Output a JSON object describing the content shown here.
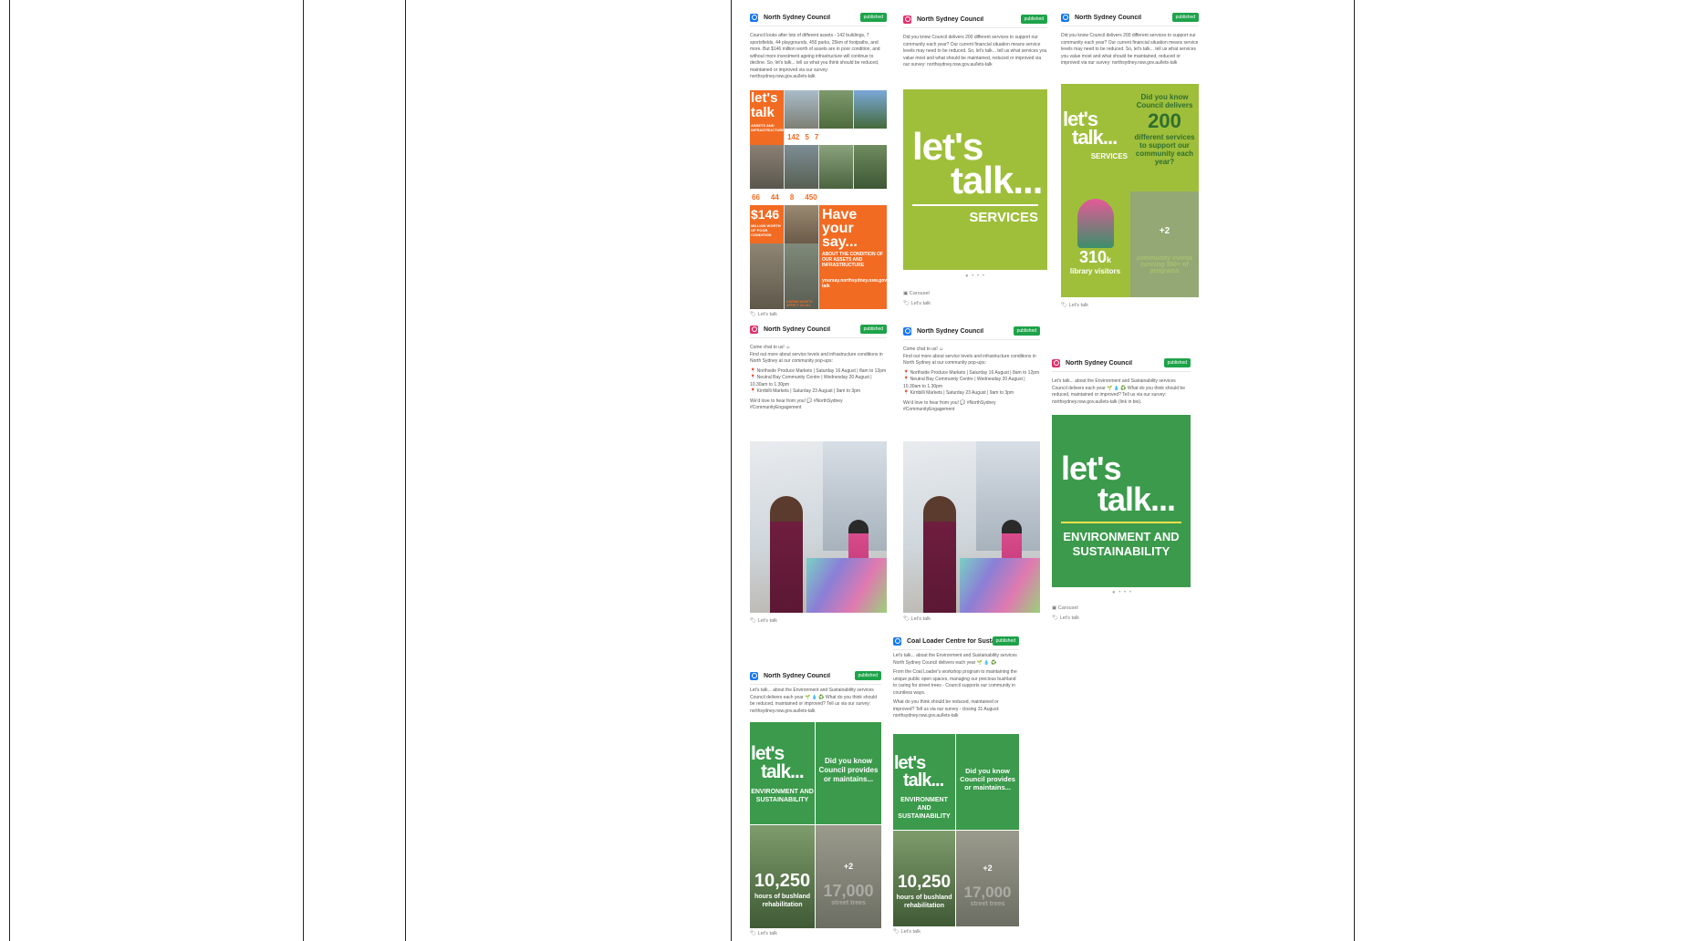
{
  "colors": {
    "ig": "#e1306c",
    "fb": "#1877f2",
    "published": "#1ea34a",
    "lime": "#9fbf3b",
    "green": "#3b9a4b",
    "orange": "#f26b22"
  },
  "posts": [
    {
      "network": "fb",
      "account": "North Sydney Council",
      "status": "published",
      "text": [
        "Council looks after lots of different assets - 142 buildings, 7 sportsfields, 44 playgrounds, 450 parks, 25km of footpaths, and more. But $146 million worth of assets are in poor condition, and without more investment ageing infrastructure will continue to decline. So, let's talk... tell us what you think should be reduced, maintained or improved via our survey: northsydney.nsw.gov.au/lets-talk"
      ],
      "tag": "Let's talk",
      "img": {
        "letsa": "let's",
        "letsb": "talk",
        "sub": "ASSETS AND INFRASTRUCTURE",
        "s1": "142",
        "s2": "5",
        "s3": "7",
        "s4": "66",
        "s5": "44",
        "s6": "8",
        "s7": "450",
        "money": "$146",
        "money_sub": "MILLION WORTH OF POOR CONDITION",
        "have": "Have your say...",
        "have_sub": "ABOUT THE CONDITION OF OUR ASSETS AND INFRASTRUCTURE",
        "url": "yoursay.northsydney.nsw.gov.au/lets-talk",
        "foot": "AGEING ASSETS AFFECT US ALL"
      }
    },
    {
      "network": "ig",
      "account": "North Sydney Council",
      "status": "published",
      "text": [
        "Did you know Council delivers 200 different services to support our community each year? Our current financial situation means service levels may need to be reduced. So, let's talk... tell us what services you value most and what should be maintained, reduced or improved via our survey: northsydney.nsw.gov.au/lets-talk"
      ],
      "img": {
        "l1": "let's",
        "l2": "talk...",
        "l3": "SERVICES"
      },
      "carousel": "Carousel",
      "tag": "Let's talk"
    },
    {
      "network": "fb",
      "account": "North Sydney Council",
      "status": "published",
      "text": [
        "Did you know Council delivers 200 different services to support our community each year? Our current financial situation means service levels may need to be reduced. So, let's talk... tell us what services you value most and what should be maintained, reduced or improved via our survey: northsydney.nsw.gov.au/lets-talk"
      ],
      "img": {
        "l1": "let's",
        "l2": "talk...",
        "l3": "SERVICES",
        "q1": "Did you know Council delivers",
        "q2": "200",
        "q3": "different services to support our community each year?",
        "stat": "310",
        "statk": "k",
        "statl": "library visitors",
        "more": "+2",
        "faded": "community events running 350+ of programs"
      },
      "tag": "Let's talk"
    },
    {
      "network": "ig",
      "account": "North Sydney Council",
      "status": "published",
      "text": [
        "Come chat to us! ☺",
        "Find out more about service levels and infrastructure conditions in North Sydney at our community pop-ups:",
        "📍 Northside Produce Markets | Saturday 16 August | 8am to 12pm",
        "📍 Neutral Bay Community Centre | Wednesday 20 August | 10.30am to 1.30pm",
        "📍 Kirribilli Markets | Saturday 23 August | 9am to 3pm",
        "We'd love to hear from you! 💬 #NorthSydney #CommunityEngagement"
      ],
      "tag": "Let's talk"
    },
    {
      "network": "fb",
      "account": "North Sydney Council",
      "status": "published",
      "text": [
        "Come chat to us! ☺",
        "Find out more about service levels and infrastructure conditions in North Sydney at our community pop-ups:",
        "📍 Northside Produce Markets | Saturday 16 August | 8am to 12pm",
        "📍 Neutral Bay Community Centre | Wednesday 20 August | 10.30am to 1.30pm",
        "📍 Kirribilli Markets | Saturday 23 August | 9am to 3pm",
        "We'd love to hear from you! 💬 #NorthSydney #CommunityEngagement"
      ],
      "tag": "Let's talk"
    },
    {
      "network": "ig",
      "account": "North Sydney Council",
      "status": "published",
      "text": [
        "Let's talk... about the Environment and Sustainability services Council delivers each year 🌱 💧 ♻️ What do you think should be reduced, maintained or improved? Tell us via our survey: northsydney.nsw.gov.au/lets-talk (link in bio)."
      ],
      "img": {
        "l1": "let's",
        "l2": "talk...",
        "l3": "ENVIRONMENT AND SUSTAINABILITY"
      },
      "carousel": "Carousel",
      "tag": "Let's talk"
    },
    {
      "network": "fb",
      "account": "North Sydney Council",
      "status": "published",
      "text": [
        "Let's talk... about the Environment and Sustainability services Council delivers each year 🌱 💧 ♻️ What do you think should be reduced, maintained or improved? Tell us via our survey: northsydney.nsw.gov.au/lets-talk"
      ],
      "img": {
        "l1": "let's",
        "l2": "talk...",
        "l3": "ENVIRONMENT AND SUSTAINABILITY",
        "q": "Did you know Council provides or maintains...",
        "stat": "10,250",
        "statl": "hours of bushland rehabilitation",
        "more": "+2",
        "faded": "17,000",
        "fadedl": "street trees"
      },
      "tag": "Let's talk"
    },
    {
      "network": "fb",
      "account": "Coal Loader Centre for Sustaina...",
      "status": "published",
      "text": [
        "Let's talk... about the Environment and Sustainability services North Sydney Council delivers each year 🌱 💧 ♻️",
        "From the Coal Loader's workshop program to maintaining the unique public open spaces, managing our precious bushland to caring for street trees - Council supports our community in countless ways.",
        "What do you think should be reduced, maintained or improved? Tell us via our survey - closing 31 August: northsydney.nsw.gov.au/lets-talk"
      ],
      "img": {
        "l1": "let's",
        "l2": "talk...",
        "l3": "ENVIRONMENT AND SUSTAINABILITY",
        "q": "Did you know Council provides or maintains...",
        "stat": "10,250",
        "statl": "hours of bushland rehabilitation",
        "more": "+2",
        "faded": "17,000",
        "fadedl": "street trees"
      },
      "tag": "Let's talk"
    }
  ]
}
